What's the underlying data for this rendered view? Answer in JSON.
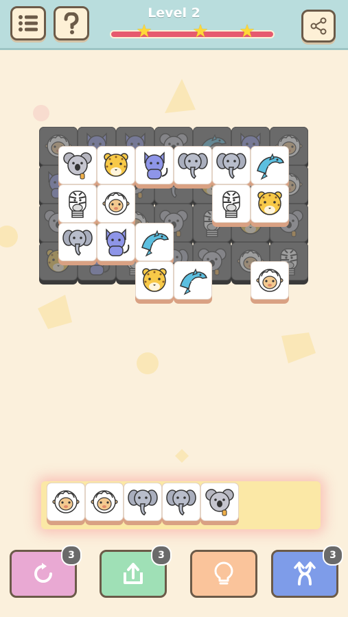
{
  "header": {
    "level_title": "Level 2",
    "stars_total": 3,
    "menu_icon": "list-menu-icon",
    "help_icon": "question-icon",
    "share_icon": "share-icon"
  },
  "colors": {
    "header_bg": "#b9dddd",
    "page_bg": "#fbf0dc",
    "progress": "#e65a6e",
    "tray": "#fbe8a6",
    "undo_btn": "#e9a9d3",
    "shuffle_out_btn": "#9fe0b6",
    "hint_btn": "#fac49b",
    "shuffle_btn": "#7e9ce9"
  },
  "board": {
    "top_tiles": [
      [
        "koala",
        "leopard",
        "cat",
        "elephant",
        "elephant",
        "dolphin"
      ],
      [
        "zebra",
        "sheep",
        "",
        "",
        "zebra",
        "leopard"
      ],
      [
        "elephant",
        "cat",
        "dolphin",
        "",
        "",
        ""
      ],
      [
        "",
        "",
        "leopard",
        "dolphin",
        "",
        "sheep"
      ]
    ]
  },
  "tray": {
    "slots": 7,
    "tiles": [
      "sheep",
      "sheep",
      "elephant",
      "elephant",
      "koala"
    ]
  },
  "powerups": [
    {
      "name": "undo",
      "icon": "undo-icon",
      "count": "3"
    },
    {
      "name": "return",
      "icon": "return-tiles-icon",
      "count": "3"
    },
    {
      "name": "hint",
      "icon": "lightbulb-icon",
      "count": ""
    },
    {
      "name": "shuffle",
      "icon": "shuffle-icon",
      "count": "3"
    }
  ]
}
